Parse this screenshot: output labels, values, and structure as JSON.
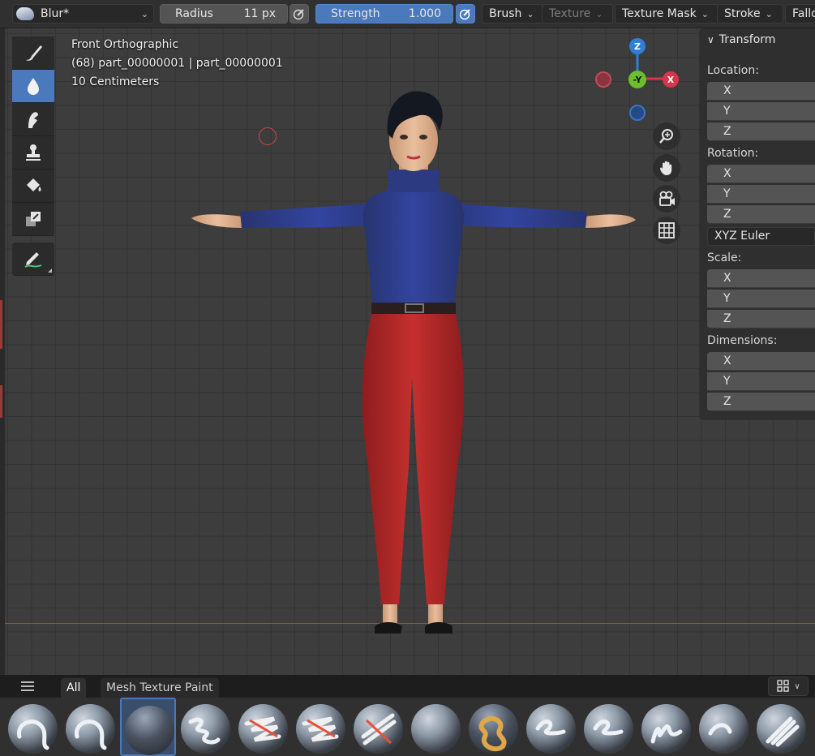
{
  "header": {
    "brush_name": "Blur*",
    "radius_label": "Radius",
    "radius_value": "11 px",
    "strength_label": "Strength",
    "strength_value": "1.000",
    "menus": [
      {
        "label": "Brush",
        "enabled": true
      },
      {
        "label": "Texture",
        "enabled": false
      },
      {
        "label": "Texture Mask",
        "enabled": true
      },
      {
        "label": "Stroke",
        "enabled": true
      },
      {
        "label": "Fallo",
        "enabled": true
      }
    ]
  },
  "toolbar": {
    "tools": [
      {
        "name": "draw-tool",
        "icon": "brush-icon"
      },
      {
        "name": "blur-tool",
        "icon": "blur-drop-icon",
        "active": true
      },
      {
        "name": "smear-tool",
        "icon": "smear-finger-icon"
      },
      {
        "name": "clone-tool",
        "icon": "stamp-icon"
      },
      {
        "name": "fill-tool",
        "icon": "paint-bucket-icon"
      },
      {
        "name": "mask-tool",
        "icon": "mask-icon"
      },
      {
        "name": "annotate-tool",
        "icon": "annotate-pencil-icon"
      }
    ]
  },
  "viewport": {
    "view_name": "Front Orthographic",
    "object_info": "(68) part_00000001 | part_00000001",
    "scale_info": "10 Centimeters",
    "gizmo": {
      "z": "Z",
      "y": "-Y",
      "x": "X",
      "color_x": "#d8354a",
      "color_y": "#6bbf2a",
      "color_z": "#2e7fd9"
    }
  },
  "npanel": {
    "section": "Transform",
    "location_label": "Location:",
    "rotation_label": "Rotation:",
    "rotation_mode": "XYZ Euler",
    "scale_label": "Scale:",
    "dimensions_label": "Dimensions:",
    "axes": [
      "X",
      "Y",
      "Z"
    ]
  },
  "shelf": {
    "tabs": [
      "All",
      "Mesh Texture Paint"
    ],
    "active_tab": "All",
    "brush_count": 14,
    "active_index": 2
  },
  "colors": {
    "accent": "#4a79bc",
    "sweater": "#2f3f86",
    "pants": "#b3292a"
  }
}
